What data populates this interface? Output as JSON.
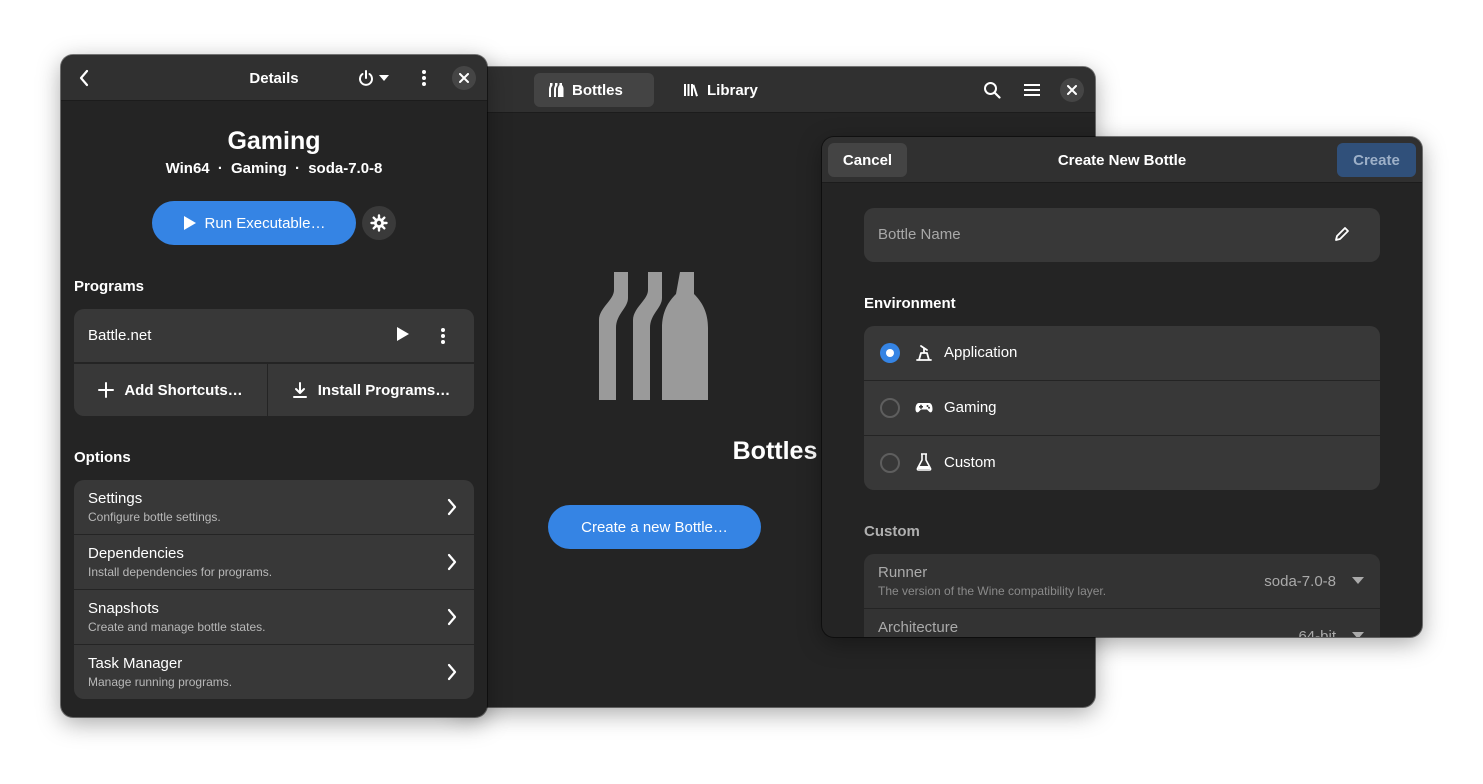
{
  "main_window": {
    "tabs": [
      {
        "label": "Bottles",
        "icon": "bottles-icon",
        "active": true
      },
      {
        "label": "Library",
        "icon": "library-icon",
        "active": false
      }
    ],
    "empty_state": {
      "title": "Bottles",
      "button_label": "Create a new Bottle…"
    }
  },
  "details_window": {
    "title": "Details",
    "bottle": {
      "name": "Gaming",
      "arch": "Win64",
      "environment": "Gaming",
      "runner": "soda-7.0-8",
      "separator": "·"
    },
    "run_button_label": "Run Executable…",
    "programs_heading": "Programs",
    "programs": [
      {
        "name": "Battle.net"
      }
    ],
    "add_shortcuts_label": "Add Shortcuts…",
    "install_programs_label": "Install Programs…",
    "options_heading": "Options",
    "options": [
      {
        "title": "Settings",
        "subtitle": "Configure bottle settings."
      },
      {
        "title": "Dependencies",
        "subtitle": "Install dependencies for programs."
      },
      {
        "title": "Snapshots",
        "subtitle": "Create and manage bottle states."
      },
      {
        "title": "Task Manager",
        "subtitle": "Manage running programs."
      }
    ]
  },
  "create_dialog": {
    "title": "Create New Bottle",
    "cancel_label": "Cancel",
    "create_label": "Create",
    "name_placeholder": "Bottle Name",
    "environment_heading": "Environment",
    "environments": [
      {
        "label": "Application",
        "icon": "application-icon",
        "selected": true
      },
      {
        "label": "Gaming",
        "icon": "gamepad-icon",
        "selected": false
      },
      {
        "label": "Custom",
        "icon": "flask-icon",
        "selected": false
      }
    ],
    "custom_heading": "Custom",
    "runner": {
      "title": "Runner",
      "subtitle": "The version of the Wine compatibility layer.",
      "value": "soda-7.0-8"
    },
    "architecture": {
      "title": "Architecture",
      "value": "64-bit"
    }
  },
  "colors": {
    "accent": "#3584e4",
    "window_bg": "#242424",
    "headerbar_bg": "#303030",
    "card_bg": "#383838",
    "create_button_bg": "#30507a"
  }
}
